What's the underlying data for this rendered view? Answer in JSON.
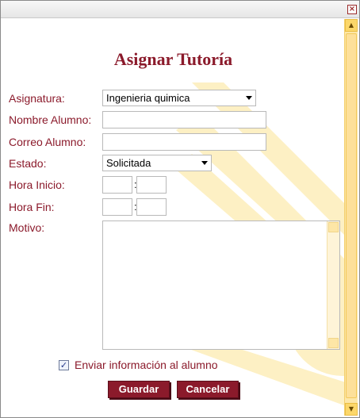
{
  "window": {
    "close_glyph": "×"
  },
  "form": {
    "title": "Asignar Tutoría",
    "asignatura": {
      "label": "Asignatura:",
      "value": "Ingenieria quimica"
    },
    "nombre": {
      "label": "Nombre Alumno:",
      "value": ""
    },
    "correo": {
      "label": "Correo Alumno:",
      "value": ""
    },
    "estado": {
      "label": "Estado:",
      "value": "Solicitada"
    },
    "hora_inicio": {
      "label": "Hora Inicio:",
      "hh": "",
      "mm": "",
      "separator": ":"
    },
    "hora_fin": {
      "label": "Hora Fin:",
      "hh": "",
      "mm": "",
      "separator": ":"
    },
    "motivo": {
      "label": "Motivo:",
      "value": ""
    },
    "enviar": {
      "label": "Enviar información al alumno",
      "checked": true
    },
    "buttons": {
      "save": "Guardar",
      "cancel": "Cancelar"
    }
  },
  "colors": {
    "accent": "#8b1a2b",
    "scrollbar": "#fde7a8"
  }
}
